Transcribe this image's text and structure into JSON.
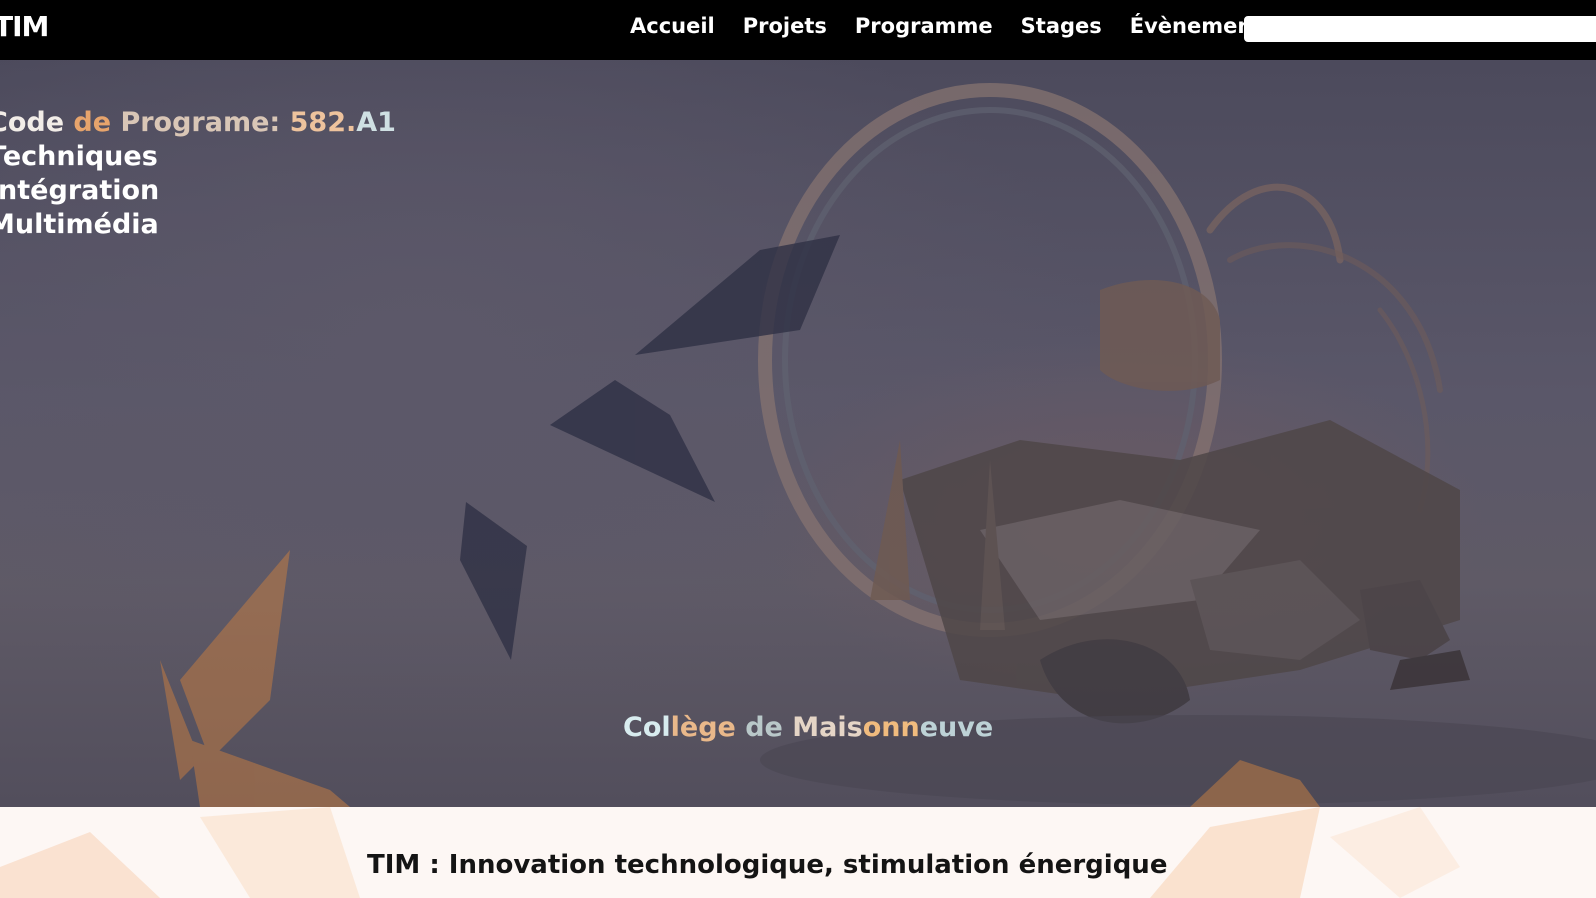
{
  "header": {
    "logo": "TIM",
    "nav": [
      "Accueil",
      "Projets",
      "Programme",
      "Stages",
      "Évènements"
    ],
    "search": {
      "value": "",
      "placeholder": ""
    }
  },
  "hero": {
    "program_code_parts": [
      "Code ",
      "de ",
      "Programe: ",
      "582.",
      "A1"
    ],
    "lines": [
      "Techniques",
      "Intégration",
      "Multimédia"
    ],
    "college_parts": [
      "Col",
      "lège ",
      "de ",
      "Mais",
      "onn",
      "euve"
    ]
  },
  "section": {
    "tagline": "TIM : Innovation technologique, stimulation énergique"
  },
  "colors": {
    "topbar": "#000000",
    "hero_base": "#55526a",
    "accent_orange": "#e7a46c",
    "accent_cyan": "#cfe0e3",
    "footer_bg": "#fdf7f4"
  }
}
